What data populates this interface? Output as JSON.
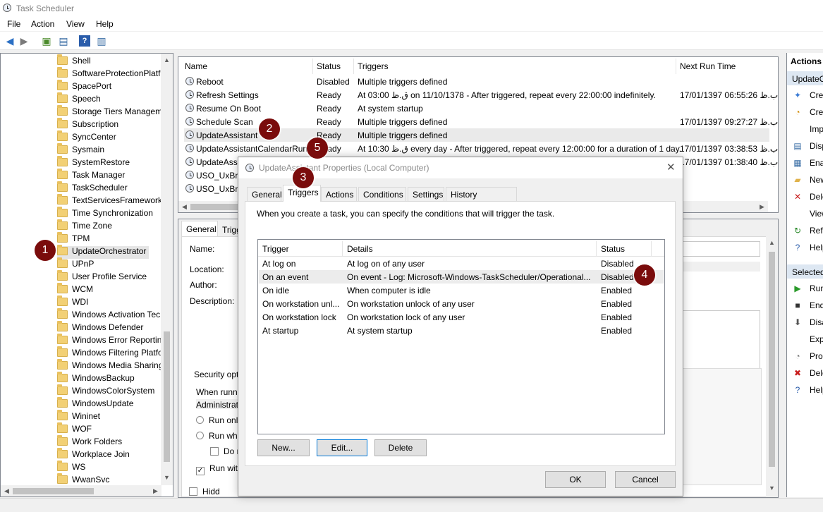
{
  "window": {
    "title": "Task Scheduler"
  },
  "menu": [
    "File",
    "Action",
    "View",
    "Help"
  ],
  "tree": {
    "items": [
      "Shell",
      "SoftwareProtectionPlatf",
      "SpacePort",
      "Speech",
      "Storage Tiers Managem",
      "Subscription",
      "SyncCenter",
      "Sysmain",
      "SystemRestore",
      "Task Manager",
      "TaskScheduler",
      "TextServicesFramework",
      "Time Synchronization",
      "Time Zone",
      "TPM",
      "UpdateOrchestrator",
      "UPnP",
      "User Profile Service",
      "WCM",
      "WDI",
      "Windows Activation Tec",
      "Windows Defender",
      "Windows Error Reportin",
      "Windows Filtering Platfo",
      "Windows Media Sharing",
      "WindowsBackup",
      "WindowsColorSystem",
      "WindowsUpdate",
      "Wininet",
      "WOF",
      "Work Folders",
      "Workplace Join",
      "WS",
      "WwanSvc"
    ],
    "selected_index": 15
  },
  "tasklist": {
    "headers": [
      "Name",
      "Status",
      "Triggers",
      "Next Run Time"
    ],
    "rows": [
      {
        "name": "Reboot",
        "status": "Disabled",
        "triggers": "Multiple triggers defined",
        "next": ""
      },
      {
        "name": "Refresh Settings",
        "status": "Ready",
        "triggers": "At 03:00 ق.ظ on 11/10/1378 - After triggered, repeat every 22:00:00 indefinitely.",
        "next": "17/01/1397 06:55:26 ب.ظ"
      },
      {
        "name": "Resume On Boot",
        "status": "Ready",
        "triggers": "At system startup",
        "next": ""
      },
      {
        "name": "Schedule Scan",
        "status": "Ready",
        "triggers": "Multiple triggers defined",
        "next": "17/01/1397 09:27:27 ب.ظ"
      },
      {
        "name": "UpdateAssistant",
        "status": "Ready",
        "triggers": "Multiple triggers defined",
        "next": ""
      },
      {
        "name": "UpdateAssistantCalendarRun",
        "status": "Ready",
        "triggers": "At 10:30 ق.ظ every day - After triggered, repeat every 12:00:00 for a duration of 1 day.",
        "next": "17/01/1397 03:38:53 ب.ظ"
      },
      {
        "name": "UpdateAssi",
        "status": "",
        "triggers": "",
        "next": "17/01/1397 01:38:40 ب.ظ"
      },
      {
        "name": "USO_UxBro",
        "status": "",
        "triggers": "",
        "next": ""
      },
      {
        "name": "USO_UxBro",
        "status": "",
        "triggers": "",
        "next": ""
      }
    ]
  },
  "details": {
    "tabs": [
      "General",
      "Trigg"
    ],
    "labels": {
      "name": "Name:",
      "location": "Location:",
      "author": "Author:",
      "description": "Description:"
    },
    "security": {
      "title": "Security opt",
      "when_running": "When runn",
      "account": "Administrat",
      "run_only": "Run onl",
      "run_whether": "Run whe",
      "do_not": "Do n",
      "run_with": "Run wit",
      "hidden": "Hidd"
    }
  },
  "actions": {
    "header": "Actions",
    "section1": "UpdateO",
    "items1": [
      "Crea",
      "Crea",
      "Imp",
      "Disp",
      "Ena",
      "New",
      "Dele",
      "View",
      "Refr",
      "Help"
    ],
    "section2": "Selected",
    "items2": [
      "Run",
      "End",
      "Disa",
      "Expo",
      "Prop",
      "Dele",
      "Help"
    ]
  },
  "dialog": {
    "title": "UpdateAssistant Properties (Local Computer)",
    "close": "✕",
    "tabs": [
      "General",
      "Triggers",
      "Actions",
      "Conditions",
      "Settings",
      "History (disabled)"
    ],
    "active_tab": 1,
    "intro": "When you create a task, you can specify the conditions that will trigger the task.",
    "table": {
      "headers": [
        "Trigger",
        "Details",
        "Status"
      ],
      "rows": [
        {
          "trigger": "At log on",
          "details": "At log on of any user",
          "status": "Disabled"
        },
        {
          "trigger": "On an event",
          "details": "On event - Log: Microsoft-Windows-TaskScheduler/Operational...",
          "status": "Disabled"
        },
        {
          "trigger": "On idle",
          "details": "When computer is idle",
          "status": "Enabled"
        },
        {
          "trigger": "On workstation unl...",
          "details": "On workstation unlock of any user",
          "status": "Enabled"
        },
        {
          "trigger": "On workstation lock",
          "details": "On workstation lock of any user",
          "status": "Enabled"
        },
        {
          "trigger": "At startup",
          "details": "At system startup",
          "status": "Enabled"
        }
      ]
    },
    "buttons": {
      "new": "New...",
      "edit": "Edit...",
      "delete": "Delete",
      "ok": "OK",
      "cancel": "Cancel"
    }
  },
  "badges": [
    "1",
    "2",
    "3",
    "4",
    "5"
  ],
  "colors": {
    "badge": "#7a0c0c",
    "selection": "#eaeaea",
    "accent_blue": "#0078d7"
  }
}
